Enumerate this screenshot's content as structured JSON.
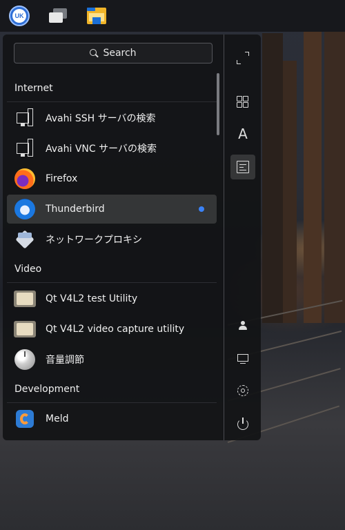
{
  "search": {
    "label": "Search"
  },
  "sections": [
    {
      "title": "Internet",
      "apps": [
        {
          "label": "Avahi SSH サーバの検索",
          "icon": "network-server-icon"
        },
        {
          "label": "Avahi VNC サーバの検索",
          "icon": "network-server-icon"
        },
        {
          "label": "Firefox",
          "icon": "firefox-icon"
        },
        {
          "label": "Thunderbird",
          "icon": "thunderbird-icon",
          "selected": true,
          "new_indicator_color": "#3b82f6"
        },
        {
          "label": "ネットワークプロキシ",
          "icon": "network-proxy-icon"
        }
      ]
    },
    {
      "title": "Video",
      "apps": [
        {
          "label": "Qt V4L2 test Utility",
          "icon": "qv4l2-icon"
        },
        {
          "label": "Qt V4L2 video capture utility",
          "icon": "qv4l2-icon"
        },
        {
          "label": "音量調節",
          "icon": "volume-control-icon"
        }
      ]
    },
    {
      "title": "Development",
      "apps": [
        {
          "label": "Meld",
          "icon": "meld-icon"
        }
      ]
    }
  ],
  "panel": {
    "items": [
      "ukui-start-menu-icon",
      "multitasking-view-icon",
      "file-manager-icon"
    ]
  },
  "sidebar_buttons": [
    "fullscreen-icon",
    "all-apps-icon",
    "letter-sort-icon",
    "category-sort-icon",
    "user-icon",
    "computer-icon",
    "settings-icon",
    "power-icon"
  ],
  "colors": {
    "menu_bg": "#121316",
    "selection": "rgba(255,255,255,0.14)",
    "accent": "#3b82f6"
  }
}
